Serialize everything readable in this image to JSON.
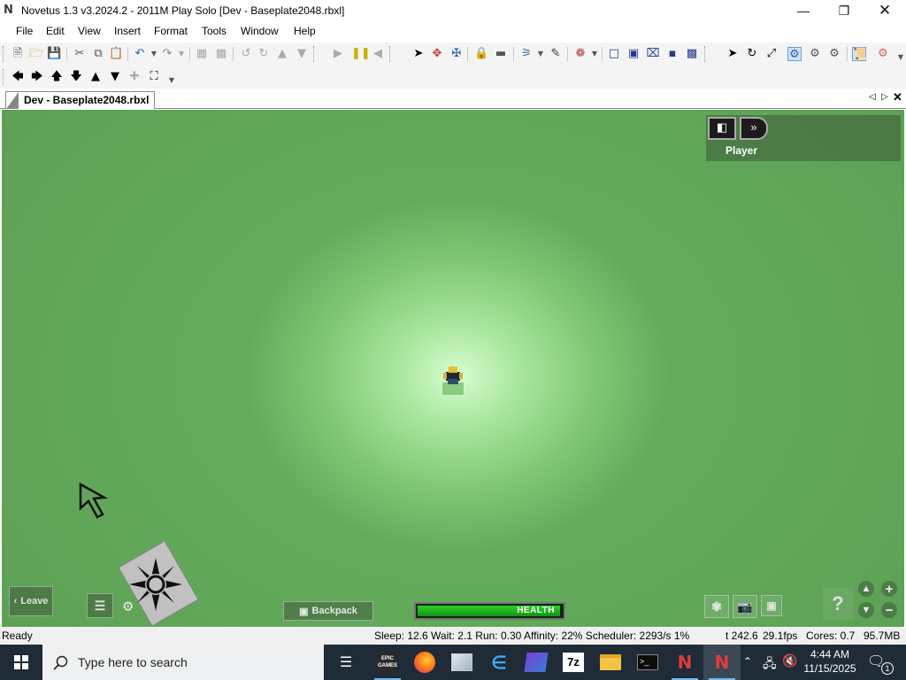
{
  "window": {
    "title": "Novetus 1.3 v3.2024.2 - 2011M Play Solo [Dev - Baseplate2048.rbxl]",
    "logo_letter": "N"
  },
  "menu": [
    "File",
    "Edit",
    "View",
    "Insert",
    "Format",
    "Tools",
    "Window",
    "Help"
  ],
  "document_tab": "Dev - Baseplate2048.rbxl",
  "game": {
    "player_label": "Player",
    "leave_label": "Leave",
    "backpack_label": "Backpack",
    "health_label": "HEALTH",
    "health_fraction": 0.99,
    "help_glyph": "?"
  },
  "status": {
    "ready": "Ready",
    "perf": "Sleep: 12.6 Wait: 2.1 Run: 0.30 Affinity: 22% Scheduler: 2293/s 1%",
    "time": "t 242.6",
    "fps": "29.1fps",
    "cores": "Cores: 0.7",
    "memory": "95.7MB"
  },
  "taskbar": {
    "search_placeholder": "Type here to search",
    "time": "4:44 AM",
    "date": "11/15/2025",
    "notification_count": "1",
    "epic_label": "EPIC GAMES",
    "sevenzip_label": "7z"
  },
  "colors": {
    "viewport_green": "#6fb965",
    "health_green": "#22b822",
    "taskbar_bg": "#1f2b36"
  }
}
